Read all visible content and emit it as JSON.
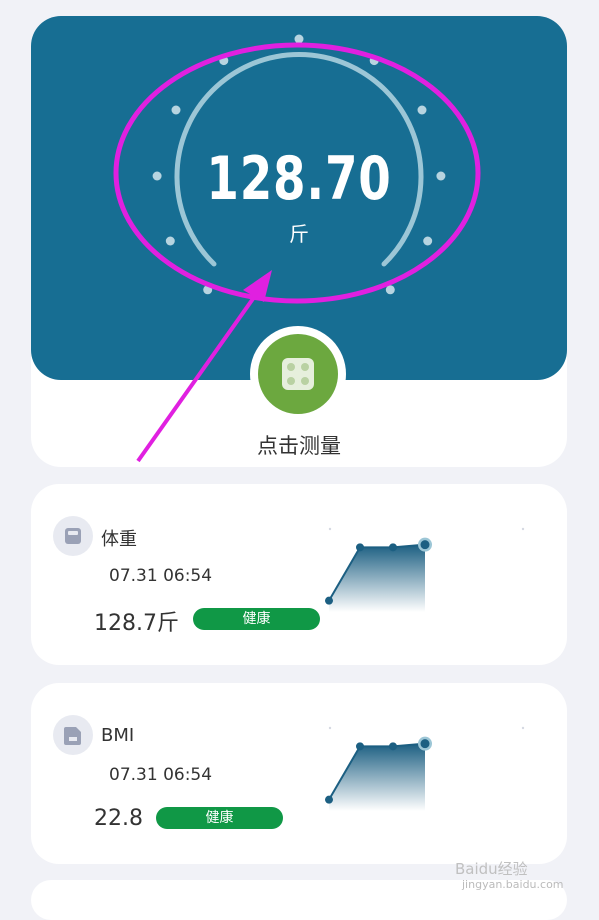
{
  "gauge": {
    "value": "128.70",
    "unit": "斤"
  },
  "measure": {
    "label": "点击测量"
  },
  "metrics": [
    {
      "title": "体重",
      "time": "07.31 06:54",
      "value": "128.7斤",
      "status": "健康",
      "trend": [
        1,
        5,
        5,
        5.2
      ]
    },
    {
      "title": "BMI",
      "time": "07.31 06:54",
      "value": "22.8",
      "status": "健康",
      "trend": [
        1,
        5,
        5,
        5.2
      ]
    }
  ],
  "watermark": {
    "brand": "Baidu经验",
    "url": "jingyan.baidu.com"
  },
  "colors": {
    "hero_bg": "#176e93",
    "button_green": "#6ca83f",
    "badge_green": "#109846",
    "annotation": "#e020e0"
  },
  "icons": [
    "scale-icon",
    "weight-icon",
    "bmi-icon"
  ]
}
